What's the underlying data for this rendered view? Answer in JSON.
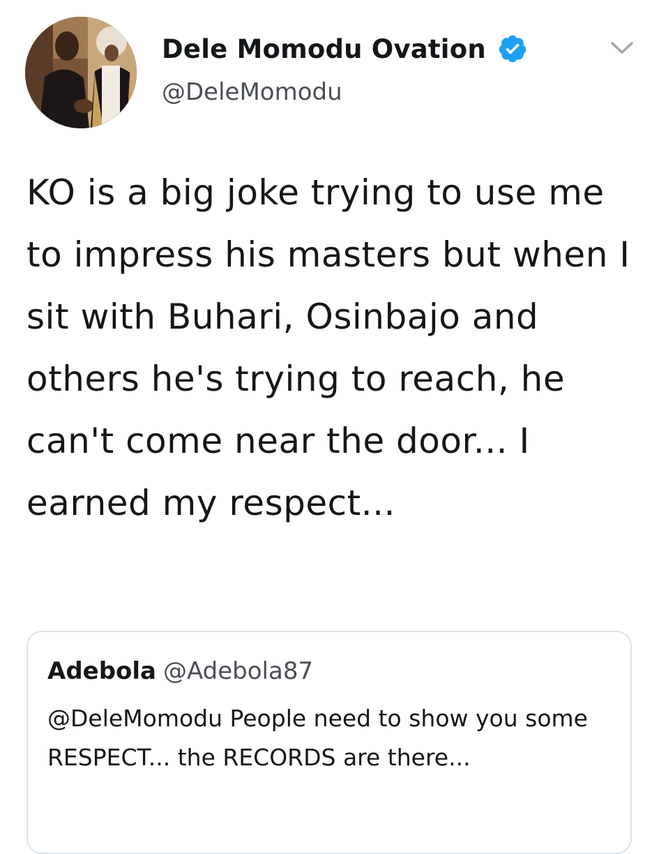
{
  "tweet": {
    "author": {
      "display_name": "Dele Momodu Ovation",
      "handle": "@DeleMomodu",
      "verified": true,
      "avatar_icon": "profile-photo"
    },
    "text": "KO is a big joke trying to use me to impress his masters but when I sit with Buhari, Osinbajo and others he's trying to reach, he can't come near the door... I earned my respect...",
    "menu_icon": "chevron-down-icon"
  },
  "quoted_tweet": {
    "author_name": "Adebola",
    "author_handle": "@Adebola87",
    "text": "@DeleMomodu People need to show you some RESPECT... the RECORDS are there..."
  },
  "colors": {
    "verified_badge": "#1da1f2",
    "text_primary": "#14171a",
    "text_secondary": "#4a4f55",
    "border": "#dce3e8",
    "caret": "#9aa5b0"
  }
}
